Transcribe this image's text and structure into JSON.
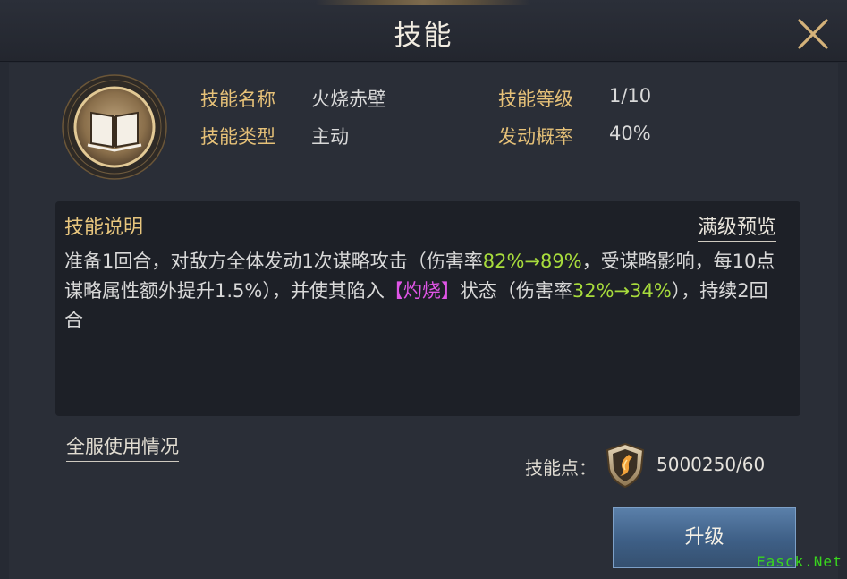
{
  "header": {
    "title": "技能"
  },
  "skill": {
    "labels": {
      "name": "技能名称",
      "type": "技能类型",
      "level": "技能等级",
      "chance": "发动概率"
    },
    "values": {
      "name": "火烧赤壁",
      "type": "主动",
      "level": "1/10",
      "chance": "40%"
    },
    "icon": "book-icon"
  },
  "description": {
    "title": "技能说明",
    "preview_link": "满级预览",
    "seg1": "准备1回合，对敌方全体发动1次谋略攻击（伤害率",
    "seg2": "82%→89%",
    "seg3": "，受谋略影响，每10点谋略属性额外提升1.5%），并使其陷入",
    "seg4": "【灼烧】",
    "seg5": "状态（伤害率",
    "seg6": "32%→34%",
    "seg7": "），持续2回合"
  },
  "footer": {
    "usage_link": "全服使用情况",
    "points_label": "技能点：",
    "points_value": "5000250/60",
    "points_icon": "skill-point-shield-icon",
    "upgrade_label": "升级"
  },
  "watermark": "Easck.Net",
  "colors": {
    "gold_label": "#e6c178",
    "highlight_green": "#a8dc3c",
    "highlight_magenta": "#e055e6",
    "button_blue": "#4a6d96"
  }
}
